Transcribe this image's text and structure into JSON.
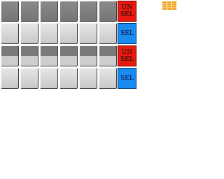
{
  "rows": [
    {
      "state": "unsel",
      "toggle_label": "UN\nSEL"
    },
    {
      "state": "sel",
      "toggle_label": "SEL"
    },
    {
      "state": "unsel",
      "toggle_label": "UN\nSEL"
    },
    {
      "state": "sel",
      "toggle_label": "SEL"
    }
  ],
  "colors": {
    "unselected": "#e8190e",
    "selected": "#1a8cf0",
    "icon": "#f0a020"
  },
  "icons": {
    "top_right": "stacked-coins-icon"
  }
}
